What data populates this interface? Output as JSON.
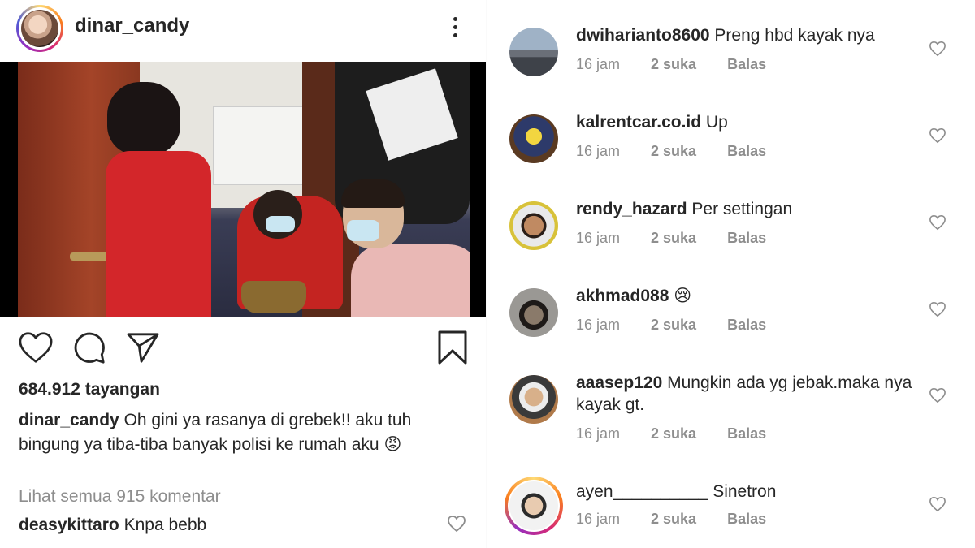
{
  "post": {
    "username": "dinar_candy",
    "views": "684.912 tayangan",
    "caption_user": "dinar_candy",
    "caption_text": "Oh gini ya rasanya di grebek!! aku tuh bingung ya tiba-tiba banyak polisi ke rumah aku 😡",
    "view_all_comments": "Lihat semua 915 komentar",
    "first_comment_user": "deasykittaro",
    "first_comment_text": "Knpa bebb"
  },
  "comments": [
    {
      "user": "dwiharianto8600",
      "text": "Preng hbd kayak nya",
      "time": "16 jam",
      "likes": "2 suka",
      "reply": "Balas"
    },
    {
      "user": "kalrentcar.co.id",
      "text": "Up",
      "time": "16 jam",
      "likes": "2 suka",
      "reply": "Balas"
    },
    {
      "user": "rendy_hazard",
      "text": "Per settingan",
      "time": "16 jam",
      "likes": "2 suka",
      "reply": "Balas"
    },
    {
      "user": "akhmad088",
      "text": "😢",
      "time": "16 jam",
      "likes": "2 suka",
      "reply": "Balas"
    },
    {
      "user": "aaasep120",
      "text": "Mungkin ada yg jebak.maka nya kayak gt.",
      "time": "16 jam",
      "likes": "2 suka",
      "reply": "Balas"
    },
    {
      "user": "ayen__________",
      "text": "Sinetron",
      "time": "16 jam",
      "likes": "2 suka",
      "reply": "Balas"
    }
  ],
  "icons": {
    "like": "heart-icon",
    "comment": "comment-icon",
    "share": "send-icon",
    "save": "bookmark-icon",
    "more": "more-options-icon"
  }
}
